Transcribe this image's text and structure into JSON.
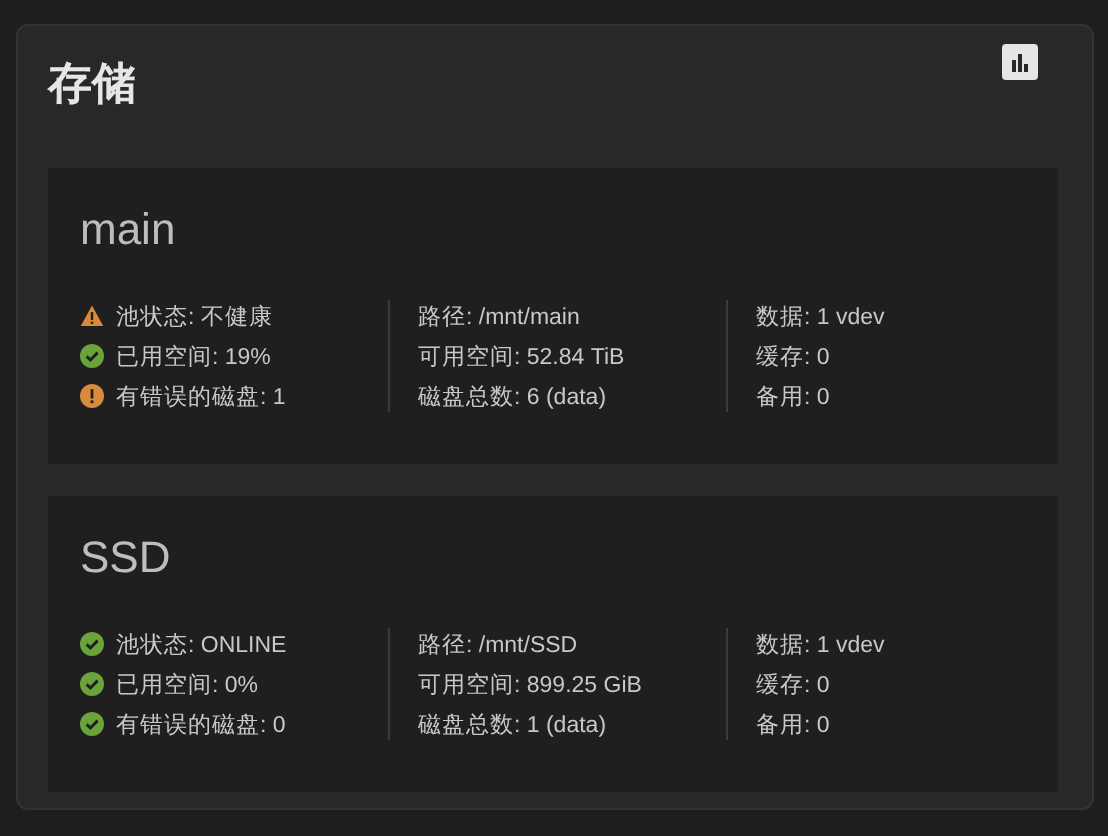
{
  "title": "存储",
  "pools": [
    {
      "name": "main",
      "status_items": [
        {
          "kind": "warning",
          "text": "池状态: 不健康"
        },
        {
          "kind": "ok",
          "text": "已用空间: 19%"
        },
        {
          "kind": "error",
          "text": "有错误的磁盘: 1"
        }
      ],
      "details": [
        "路径: /mnt/main",
        "可用空间: 52.84 TiB",
        "磁盘总数: 6 (data)"
      ],
      "topology": [
        "数据: 1 vdev",
        "缓存: 0",
        "备用: 0"
      ]
    },
    {
      "name": "SSD",
      "status_items": [
        {
          "kind": "ok",
          "text": "池状态: ONLINE"
        },
        {
          "kind": "ok",
          "text": "已用空间: 0%"
        },
        {
          "kind": "ok",
          "text": "有错误的磁盘: 0"
        }
      ],
      "details": [
        "路径: /mnt/SSD",
        "可用空间: 899.25 GiB",
        "磁盘总数: 1 (data)"
      ],
      "topology": [
        "数据: 1 vdev",
        "缓存: 0",
        "备用: 0"
      ]
    }
  ]
}
